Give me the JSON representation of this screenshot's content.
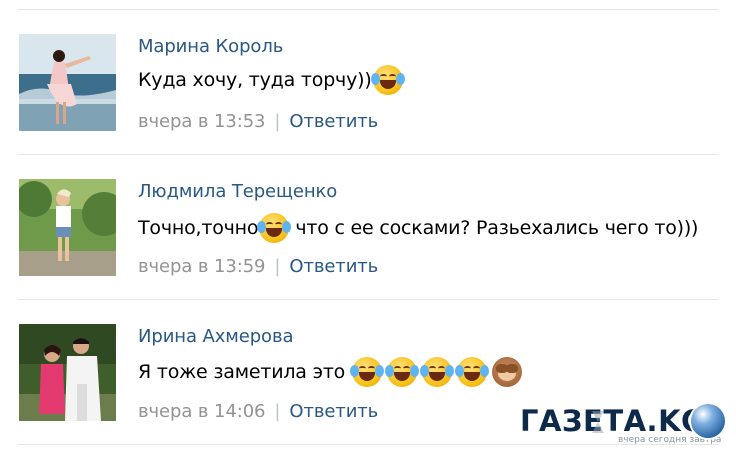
{
  "comments": [
    {
      "author": "Марина Король",
      "text": "Куда хочу, туда торчу))",
      "time": "вчера в 13:53",
      "reply": "Ответить"
    },
    {
      "author": "Людмила Терещенко",
      "text_before": "Точно,точно",
      "text_after": "что с ее сосками? Разьехались чего то)))",
      "time": "вчера в 13:59",
      "reply": "Ответить"
    },
    {
      "author": "Ирина Ахмерова",
      "text": "Я тоже заметила это",
      "time": "вчера в 14:06",
      "reply": "Ответить"
    }
  ],
  "separator": "|",
  "emojis": {
    "comment1": [
      "tears-of-joy"
    ],
    "comment2": [
      "tears-of-joy"
    ],
    "comment3": [
      "tears-of-joy",
      "tears-of-joy",
      "tears-of-joy",
      "tears-of-joy",
      "see-no-evil-monkey"
    ]
  },
  "watermark": {
    "name": "ГАЗЕТА.KG",
    "tagline": "вчера сегодня завтра"
  },
  "colors": {
    "link": "#2a5885",
    "meta": "#939393",
    "divider": "#e4e6ea"
  }
}
